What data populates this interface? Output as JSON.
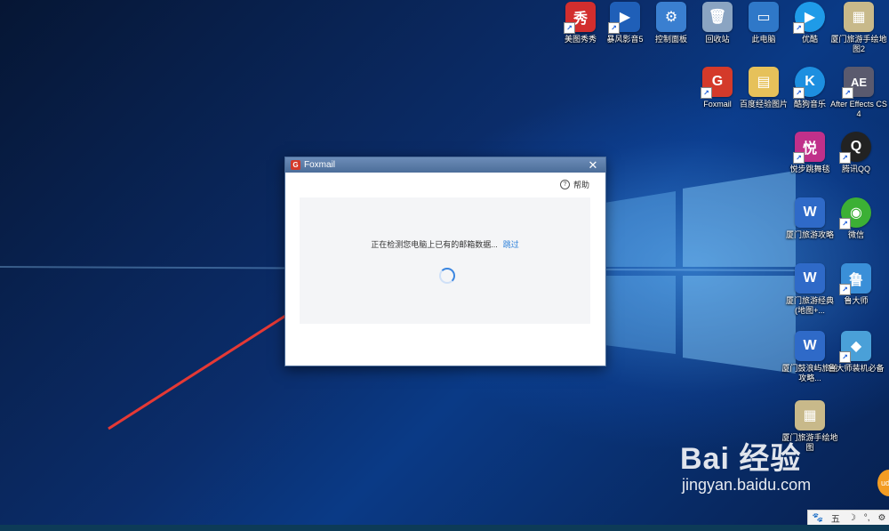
{
  "desktop": {
    "icons": [
      {
        "label": "美图秀秀",
        "icon": "meitu-icon",
        "glyph": "秀",
        "color": "#d22e2e"
      },
      {
        "label": "暴风影音5",
        "icon": "video-player-icon",
        "glyph": "▶",
        "color": "#1f5fb8"
      },
      {
        "label": "控制面板",
        "icon": "control-panel-icon",
        "glyph": "⚙",
        "color": "#3a7fd0"
      },
      {
        "label": "回收站",
        "icon": "recycle-bin-icon",
        "glyph": "🗑",
        "color": "#8aa4c2"
      },
      {
        "label": "此电脑",
        "icon": "computer-icon",
        "glyph": "▭",
        "color": "#2f78c8"
      },
      {
        "label": "优酷",
        "icon": "youku-icon",
        "glyph": "▶",
        "color": "#1f9be8"
      },
      {
        "label": "厦门旅游手绘地图2",
        "icon": "map-icon",
        "glyph": "▦",
        "color": "#c8b98a"
      },
      {
        "label": "Foxmail",
        "icon": "foxmail-icon",
        "glyph": "G",
        "color": "#d43a2a"
      },
      {
        "label": "百度经验图片",
        "icon": "folder-icon",
        "glyph": "▤",
        "color": "#e6c15a"
      },
      {
        "label": "酷狗音乐",
        "icon": "kugou-icon",
        "glyph": "K",
        "color": "#1d8fe0"
      },
      {
        "label": "After Effects CS4",
        "icon": "after-effects-icon",
        "glyph": "AE",
        "color": "#5a5a6e"
      },
      {
        "label": "悦步跳舞毯",
        "icon": "dance-mat-icon",
        "glyph": "悦",
        "color": "#c0308a"
      },
      {
        "label": "腾讯QQ",
        "icon": "qq-icon",
        "glyph": "Q",
        "color": "#222"
      },
      {
        "label": "厦门旅游攻略",
        "icon": "word-doc-icon",
        "glyph": "W",
        "color": "#2f6ac8"
      },
      {
        "label": "微信",
        "icon": "wechat-icon",
        "glyph": "◉",
        "color": "#3cb035"
      },
      {
        "label": "厦门旅游经典(地图+...",
        "icon": "word-doc-icon",
        "glyph": "W",
        "color": "#2f6ac8"
      },
      {
        "label": "鲁大师",
        "icon": "ludashi-icon",
        "glyph": "鲁",
        "color": "#3a8fd8"
      },
      {
        "label": "厦门鼓浪屿旅游攻略...",
        "icon": "word-doc-icon",
        "glyph": "W",
        "color": "#2f6ac8"
      },
      {
        "label": "鲁大师装机必备",
        "icon": "ludashi-toolbox-icon",
        "glyph": "◆",
        "color": "#4aa0d8"
      },
      {
        "label": "厦门旅游手绘地图",
        "icon": "map-icon",
        "glyph": "▦",
        "color": "#c8b98a"
      }
    ]
  },
  "dialog": {
    "title": "Foxmail",
    "help_label": "帮助",
    "status_text": "正在检测您电脑上已有的邮箱数据...",
    "skip_label": "跳过"
  },
  "watermark": {
    "main": "Bai  经验",
    "sub": "jingyan.baidu.com"
  },
  "ime": {
    "items": [
      "五",
      "☽",
      "°,",
      "⚙"
    ]
  },
  "colors": {
    "accent_link": "#2b7fd9",
    "arrow": "#e53935"
  }
}
